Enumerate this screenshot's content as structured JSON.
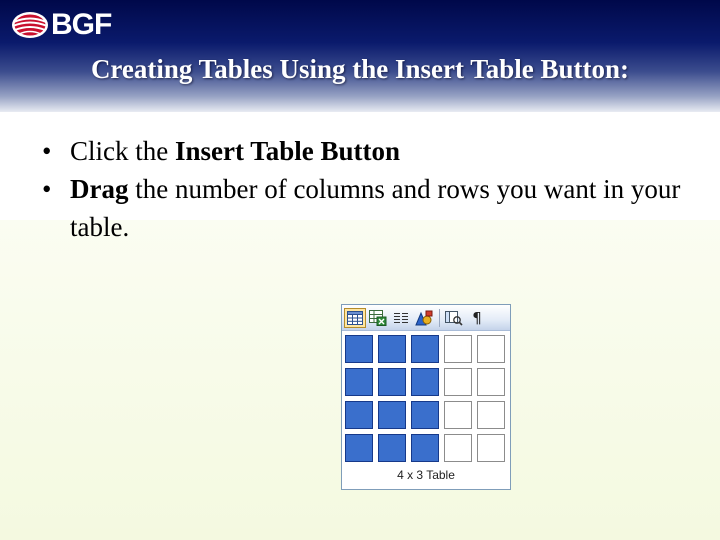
{
  "header": {
    "logo_text": "BGF",
    "title": "Creating Tables Using the Insert Table Button:"
  },
  "bullets": [
    {
      "plain_before": "Click the ",
      "bold": "Insert Table Button",
      "plain_after": ""
    },
    {
      "plain_before": "",
      "bold": "Drag",
      "plain_after": " the number of columns and rows you want in your table."
    }
  ],
  "bullet_char": "•",
  "table_picker": {
    "toolbar_icons": [
      "insert-table-icon",
      "insert-excel-worksheet-icon",
      "columns-icon",
      "drawing-icon",
      "document-map-icon",
      "show-hide-formatting-icon"
    ],
    "pilcrow": "¶",
    "grid_rows": 4,
    "grid_cols": 5,
    "selected_rows": 4,
    "selected_cols": 3,
    "size_label": "4 x 3 Table"
  },
  "colors": {
    "header_dark": "#00084a",
    "selected_cell": "#3a6fcc",
    "picker_border": "#7f9db9"
  }
}
